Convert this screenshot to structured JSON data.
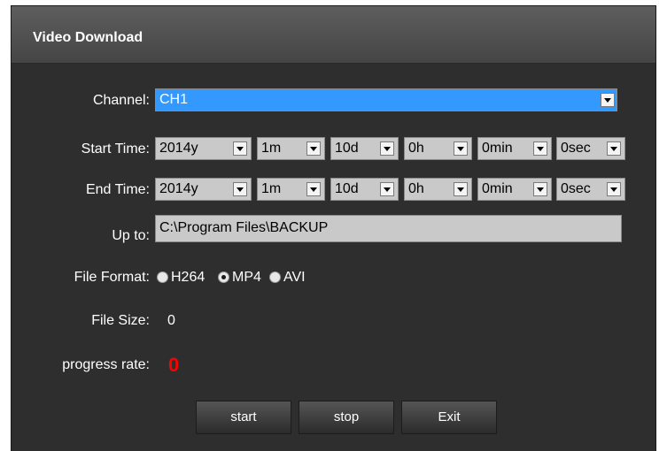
{
  "title": "Video Download",
  "channel": {
    "label": "Channel:",
    "value": "CH1"
  },
  "start_time": {
    "label": "Start Time:",
    "year": "2014y",
    "month": "1m",
    "day": "10d",
    "hour": "0h",
    "minute": "0min",
    "second": "0sec"
  },
  "end_time": {
    "label": "End Time:",
    "year": "2014y",
    "month": "1m",
    "day": "10d",
    "hour": "0h",
    "minute": "0min",
    "second": "0sec"
  },
  "up_to": {
    "label": "Up to:",
    "value": "C:\\Program Files\\BACKUP"
  },
  "file_format": {
    "label": "File Format:",
    "options": [
      "H264",
      "MP4",
      "AVI"
    ],
    "selected": "MP4"
  },
  "file_size": {
    "label": "File Size:",
    "value": "0"
  },
  "progress": {
    "label": "progress rate:",
    "value": "0"
  },
  "buttons": {
    "start": "start",
    "stop": "stop",
    "exit": "Exit"
  },
  "colors": {
    "background": "#2e2e2e",
    "titlebar": "#4f4f4f",
    "selection": "#3399ff",
    "progress": "#ff0000"
  }
}
